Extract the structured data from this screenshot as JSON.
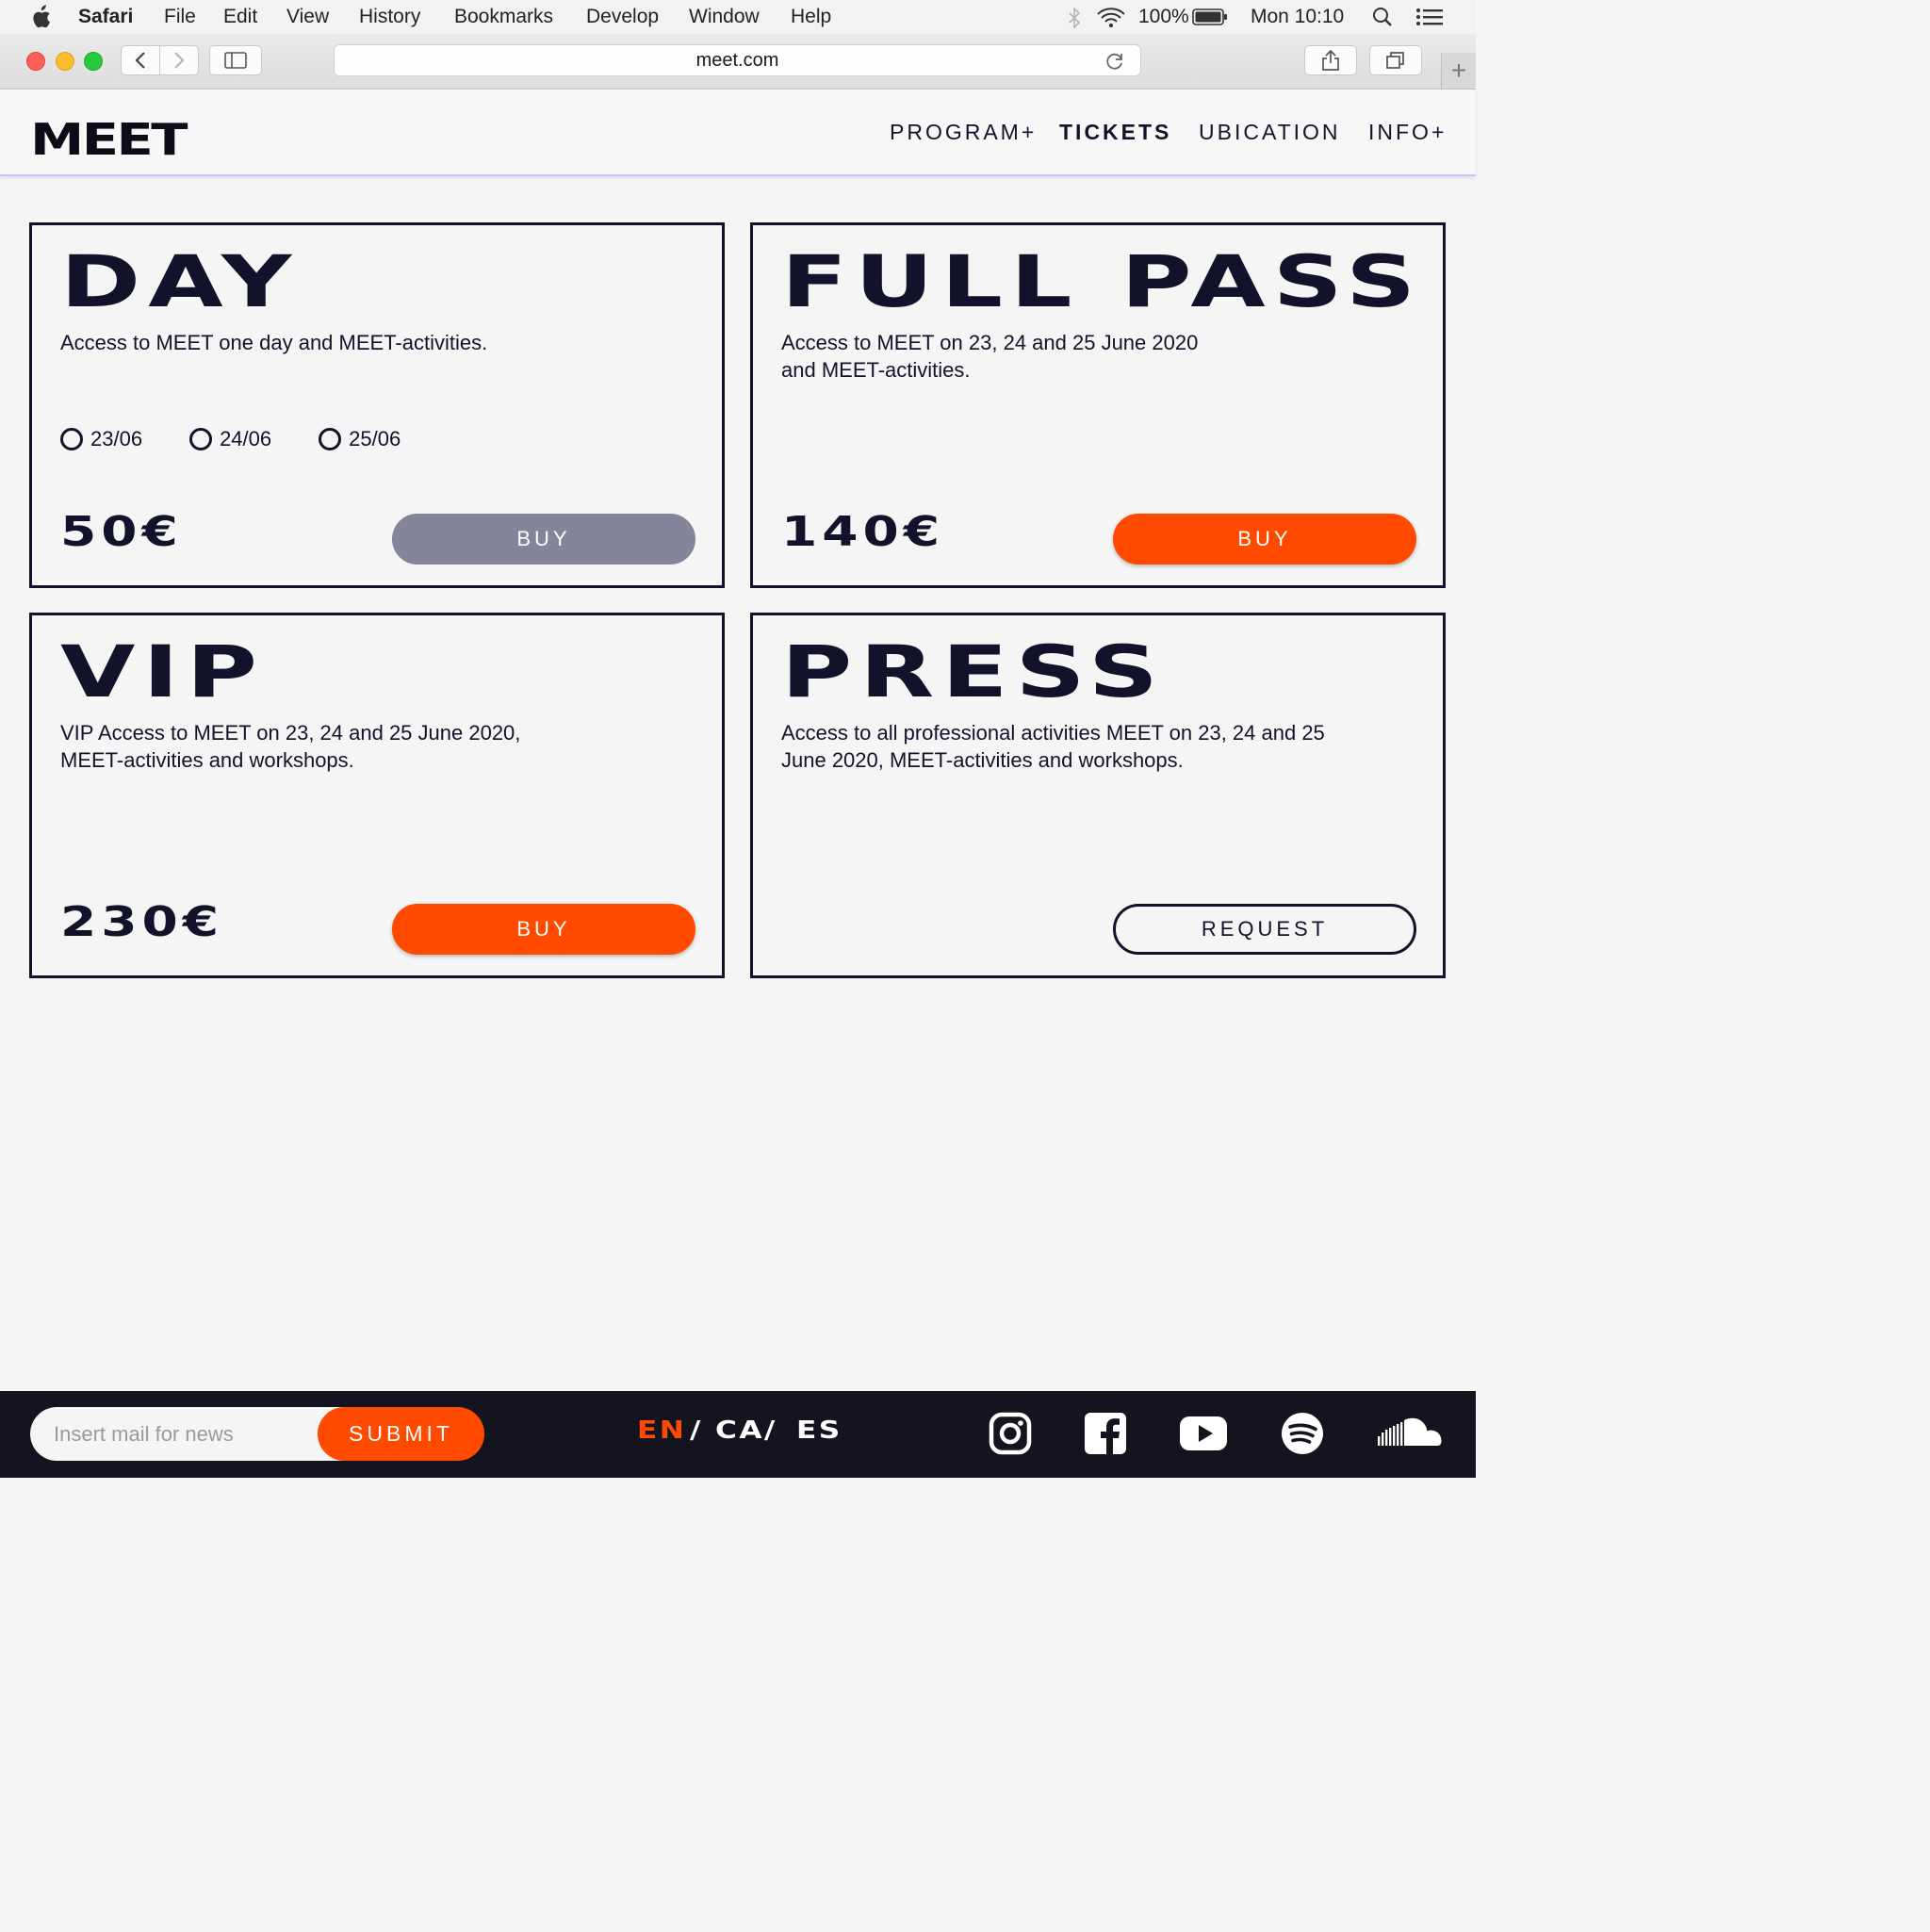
{
  "menubar": {
    "app": "Safari",
    "items": [
      "File",
      "Edit",
      "View",
      "History",
      "Bookmarks",
      "Develop",
      "Window",
      "Help"
    ],
    "battery": "100%",
    "clock": "Mon 10:10"
  },
  "browser": {
    "url": "meet.com",
    "new_tab": "+"
  },
  "site": {
    "logo": "MEET",
    "nav": [
      "PROGRAM+",
      "TICKETS",
      "UBICATION",
      "INFO+"
    ],
    "active_nav": "TICKETS"
  },
  "tickets": [
    {
      "title": "DAY",
      "description": "Access to MEET one day and MEET-activities.",
      "dates": [
        "23/06",
        "24/06",
        "25/06"
      ],
      "price": "50€",
      "button": "BUY",
      "button_state": "disabled"
    },
    {
      "title": "FULL PASS",
      "description_lines": [
        "Access to MEET on 23, 24 and 25 June 2020",
        "and MEET-activities."
      ],
      "price": "140€",
      "button": "BUY",
      "button_state": "enabled"
    },
    {
      "title": "VIP",
      "description_lines": [
        "VIP Access to MEET on 23, 24 and 25 June 2020,",
        "MEET-activities and workshops."
      ],
      "price": "230€",
      "button": "BUY",
      "button_state": "enabled"
    },
    {
      "title": "PRESS",
      "description_lines": [
        "Access to all professional activities MEET on 23, 24 and 25",
        "June 2020, MEET-activities and workshops."
      ],
      "button": "REQUEST",
      "button_state": "outline"
    }
  ],
  "footer": {
    "newsletter_placeholder": "Insert mail for news",
    "submit": "SUBMIT",
    "languages": [
      "EN",
      "/ CA/",
      "ES"
    ],
    "active_language": "EN",
    "social_icons": [
      "instagram-icon",
      "facebook-icon",
      "youtube-icon",
      "spotify-icon",
      "soundcloud-icon"
    ]
  },
  "colors": {
    "accent": "#ff4a00",
    "ink": "#12122a",
    "disabled": "#84859a",
    "footer_bg": "#14141e"
  }
}
